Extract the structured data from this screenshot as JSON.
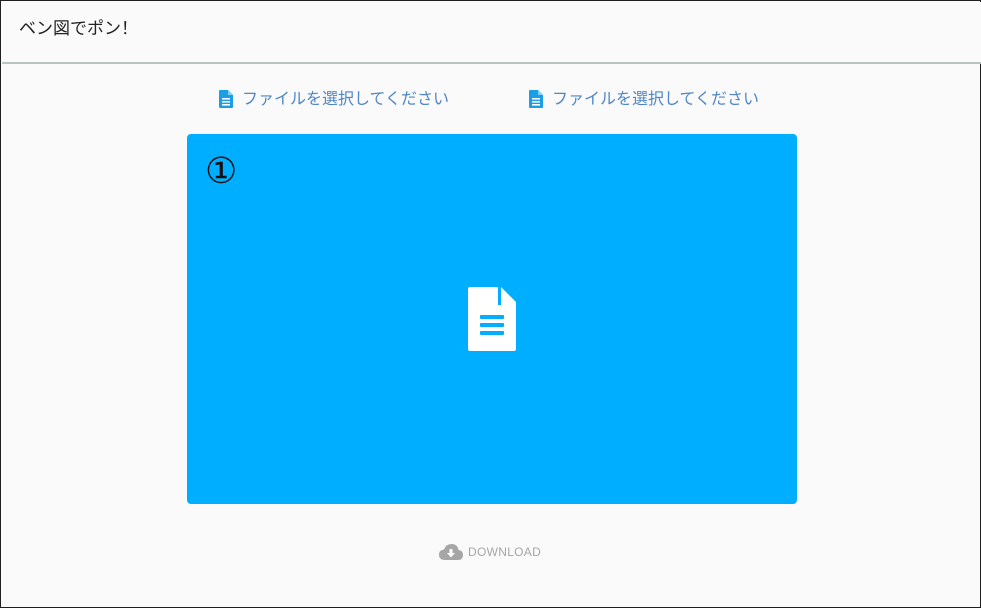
{
  "app": {
    "title": "ベン図でポン！"
  },
  "file_pickers": [
    {
      "label": "ファイルを選択してください",
      "icon": "file-icon"
    },
    {
      "label": "ファイルを選択してください",
      "icon": "file-icon"
    }
  ],
  "drop_area": {
    "number": "①",
    "icon": "document-icon",
    "color": "#00aeff"
  },
  "download": {
    "label": "DOWNLOAD",
    "icon": "cloud-download-icon"
  },
  "colors": {
    "accent": "#00aeff",
    "link": "#4f86c6",
    "disabled": "#a6a6a6",
    "divider": "#b9c3bf"
  }
}
